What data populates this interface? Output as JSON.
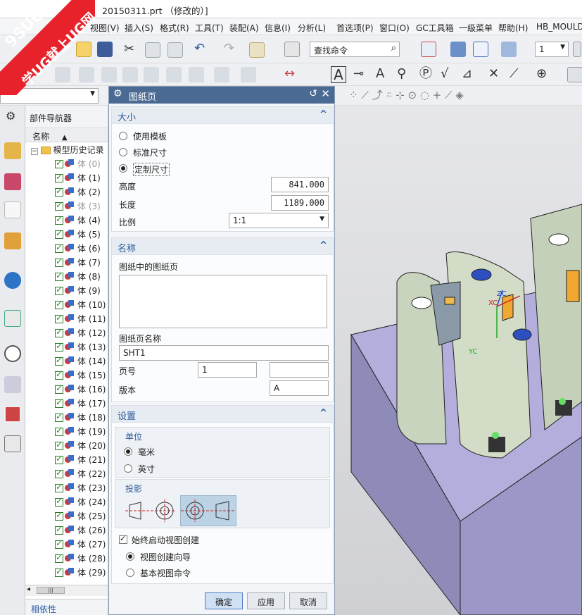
{
  "window": {
    "title": "20150311.prt （修改的）]"
  },
  "watermark": {
    "text1": "9SUG",
    "text2": "学UG就上UG网"
  },
  "menubar": {
    "items": [
      "视图(V)",
      "插入(S)",
      "格式(R)",
      "工具(T)",
      "装配(A)",
      "信息(I)",
      "分析(L)",
      "首选项(P)",
      "窗口(O)",
      "GC工具箱",
      "一级菜单",
      "帮助(H)",
      "HB_MOULD"
    ]
  },
  "toolbar": {
    "search_placeholder": "查找命令",
    "layer_value": "1"
  },
  "navigator": {
    "title": "部件导航器",
    "col_name": "名称",
    "sort_arrow": "▲",
    "expand": "−",
    "root": "模型历史记录",
    "rows": [
      {
        "label": "体 (0)",
        "dim": true
      },
      {
        "label": "体 (1)",
        "dim": false
      },
      {
        "label": "体 (2)",
        "dim": false
      },
      {
        "label": "体 (3)",
        "dim": true
      },
      {
        "label": "体 (4)",
        "dim": false
      },
      {
        "label": "体 (5)",
        "dim": false
      },
      {
        "label": "体 (6)",
        "dim": false
      },
      {
        "label": "体 (7)",
        "dim": false
      },
      {
        "label": "体 (8)",
        "dim": false
      },
      {
        "label": "体 (9)",
        "dim": false
      },
      {
        "label": "体 (10)",
        "dim": false
      },
      {
        "label": "体 (11)",
        "dim": false
      },
      {
        "label": "体 (12)",
        "dim": false
      },
      {
        "label": "体 (13)",
        "dim": false
      },
      {
        "label": "体 (14)",
        "dim": false
      },
      {
        "label": "体 (15)",
        "dim": false
      },
      {
        "label": "体 (16)",
        "dim": false
      },
      {
        "label": "体 (17)",
        "dim": false
      },
      {
        "label": "体 (18)",
        "dim": false
      },
      {
        "label": "体 (19)",
        "dim": false
      },
      {
        "label": "体 (20)",
        "dim": false
      },
      {
        "label": "体 (21)",
        "dim": false
      },
      {
        "label": "体 (22)",
        "dim": false
      },
      {
        "label": "体 (23)",
        "dim": false
      },
      {
        "label": "体 (24)",
        "dim": false
      },
      {
        "label": "体 (25)",
        "dim": false
      },
      {
        "label": "体 (26)",
        "dim": false
      },
      {
        "label": "体 (27)",
        "dim": false
      },
      {
        "label": "体 (28)",
        "dim": false
      },
      {
        "label": "体 (29)",
        "dim": false
      }
    ],
    "bottom": "相依性",
    "scroll_grip": "|||"
  },
  "dialog": {
    "title": "图纸页",
    "size": {
      "title": "大小",
      "opt_template": "使用模板",
      "opt_standard": "标准尺寸",
      "opt_custom": "定制尺寸",
      "height_label": "高度",
      "height_value": "841.000",
      "length_label": "长度",
      "length_value": "1189.000",
      "scale_label": "比例",
      "scale_value": "1:1"
    },
    "name": {
      "title": "名称",
      "sheets_label": "图纸中的图纸页",
      "sheet_name_label": "图纸页名称",
      "sheet_name_value": "SHT1",
      "page_label": "页号",
      "page_value": "1",
      "page_extra": "",
      "rev_label": "版本",
      "rev_value": "A"
    },
    "settings": {
      "title": "设置",
      "units_title": "单位",
      "opt_mm": "毫米",
      "opt_inch": "英寸",
      "proj_title": "投影",
      "always_start": "始终启动视图创建",
      "opt_wizard": "视图创建向导",
      "opt_base": "基本视图命令"
    },
    "buttons": {
      "ok": "确定",
      "apply": "应用",
      "cancel": "取消"
    }
  },
  "viewport": {
    "axis_xc": "XC",
    "axis_yc": "YC",
    "axis_zc": "ZC"
  },
  "colors": {
    "accent": "#4b6a93",
    "group_title": "#2e5d9b",
    "model_face": "#c3cfb7",
    "base_plate": "#b0acd8"
  }
}
